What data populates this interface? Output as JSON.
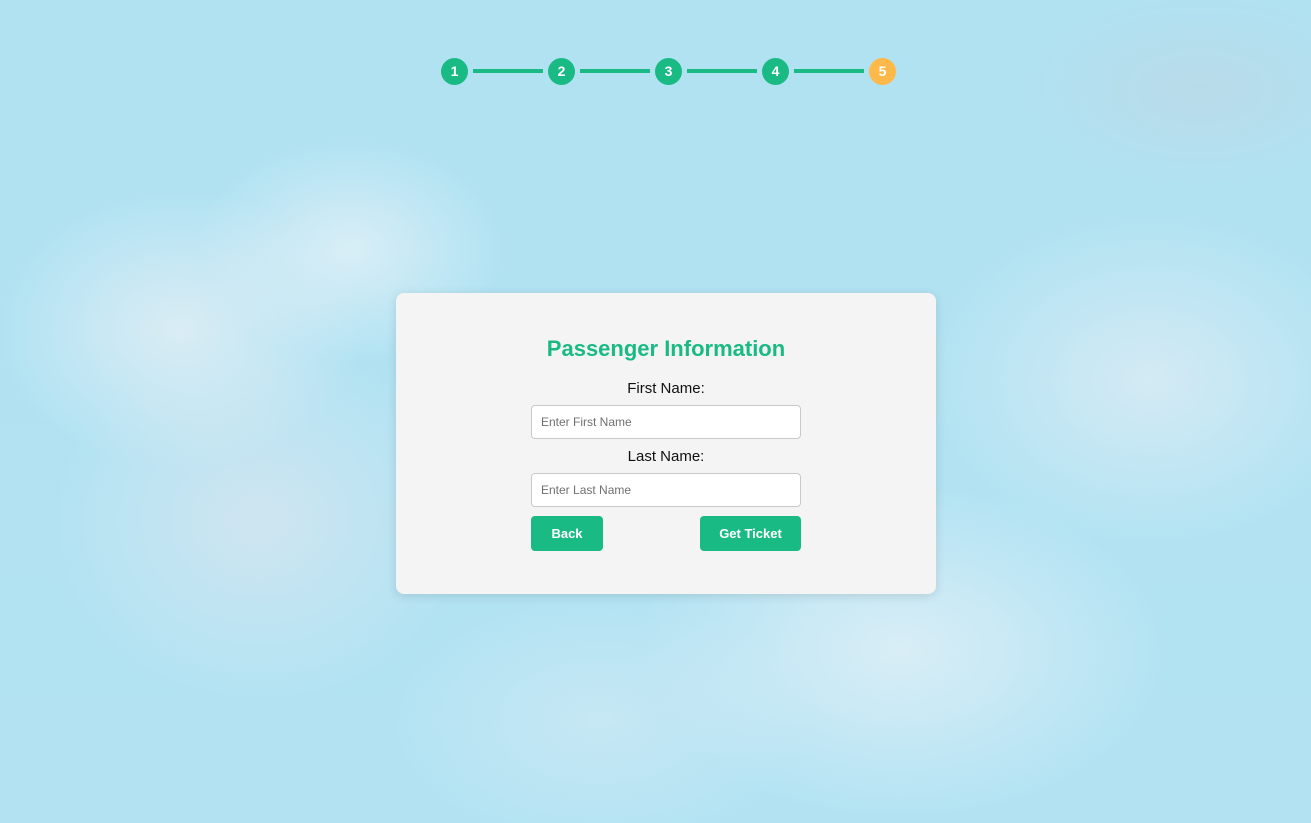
{
  "stepper": {
    "steps": [
      {
        "label": "1",
        "state": "complete"
      },
      {
        "label": "2",
        "state": "complete"
      },
      {
        "label": "3",
        "state": "complete"
      },
      {
        "label": "4",
        "state": "complete"
      },
      {
        "label": "5",
        "state": "current"
      }
    ],
    "complete_color": "#1aba84",
    "current_color": "#ffb84a"
  },
  "form": {
    "title": "Passenger Information",
    "first_name": {
      "label": "First Name:",
      "placeholder": "Enter First Name",
      "value": ""
    },
    "last_name": {
      "label": "Last Name:",
      "placeholder": "Enter Last Name",
      "value": ""
    },
    "back_label": "Back",
    "submit_label": "Get Ticket"
  },
  "theme": {
    "accent": "#1aba84",
    "card_background": "#f4f4f4",
    "page_background": "#b2e3f3"
  }
}
